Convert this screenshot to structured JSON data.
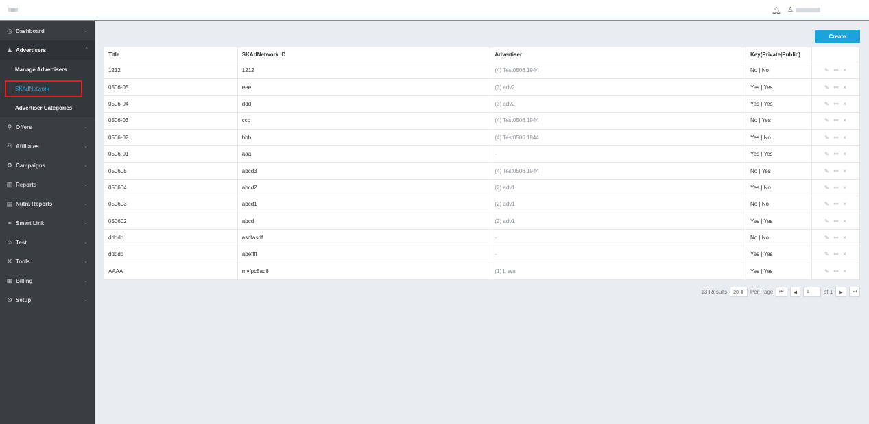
{
  "header": {
    "bell_icon": "bell-icon",
    "user_icon": "user-icon"
  },
  "sidebar": {
    "items": [
      {
        "label": "Dashboard",
        "icon": "◷",
        "chev": "⌄"
      },
      {
        "label": "Advertisers",
        "icon": "♟",
        "chev": "^"
      },
      {
        "label": "Offers",
        "icon": "⚲",
        "chev": "⌄"
      },
      {
        "label": "Affiliates",
        "icon": "⚇",
        "chev": "⌄"
      },
      {
        "label": "Campaigns",
        "icon": "⚙",
        "chev": "⌄"
      },
      {
        "label": "Reports",
        "icon": "▥",
        "chev": "⌄"
      },
      {
        "label": "Nutra Reports",
        "icon": "▤",
        "chev": "⌄"
      },
      {
        "label": "Smart Link",
        "icon": "⚭",
        "chev": "⌄"
      },
      {
        "label": "Test",
        "icon": "☺",
        "chev": "⌄"
      },
      {
        "label": "Tools",
        "icon": "✕",
        "chev": "⌄"
      },
      {
        "label": "Billing",
        "icon": "▦",
        "chev": "⌄"
      },
      {
        "label": "Setup",
        "icon": "⚙",
        "chev": "⌄"
      }
    ],
    "sub_items": [
      {
        "label": "Manage Advertisers"
      },
      {
        "label": "SKAdNetwork"
      },
      {
        "label": "Advertiser Categories"
      }
    ]
  },
  "toolbar": {
    "create_label": "Create"
  },
  "table": {
    "headers": [
      "Title",
      "SKAdNetwork ID",
      "Advertiser",
      "Key(Private|Public)",
      ""
    ],
    "rows": [
      [
        "1212",
        "1212",
        "(4) Test0506.1944",
        "No | No"
      ],
      [
        "0506-05",
        "eee",
        "(3) adv2",
        "Yes | Yes"
      ],
      [
        "0506-04",
        "ddd",
        "(3) adv2",
        "Yes | Yes"
      ],
      [
        "0506-03",
        "ccc",
        "(4) Test0506.1944",
        "No | Yes"
      ],
      [
        "0506-02",
        "bbb",
        "(4) Test0506.1944",
        "Yes | No"
      ],
      [
        "0506-01",
        "aaa",
        "-",
        "Yes | Yes"
      ],
      [
        "050605",
        "abcd3",
        "(4) Test0506.1944",
        "No | Yes"
      ],
      [
        "050604",
        "abcd2",
        "(2) adv1",
        "Yes | No"
      ],
      [
        "050603",
        "abcd1",
        "(2) adv1",
        "No | No"
      ],
      [
        "050602",
        "abcd",
        "(2) adv1",
        "Yes | Yes"
      ],
      [
        "ddddd",
        "asdfasdf",
        "-",
        "No | No"
      ],
      [
        "ddddd",
        "abeffff",
        "-",
        "Yes | Yes"
      ],
      [
        "AAAA",
        "mvfpc5aq8",
        "(1) L Wu",
        "Yes | Yes"
      ]
    ],
    "actions": {
      "edit": "✎",
      "link": "⚯",
      "delete": "×"
    }
  },
  "pagination": {
    "results": "13 Results",
    "per_page_value": "20 ⇕",
    "per_page_label": "Per Page",
    "first": "⏮",
    "prev": "◀",
    "page": "1",
    "of": "of 1",
    "next": "▶",
    "last": "⏭"
  }
}
